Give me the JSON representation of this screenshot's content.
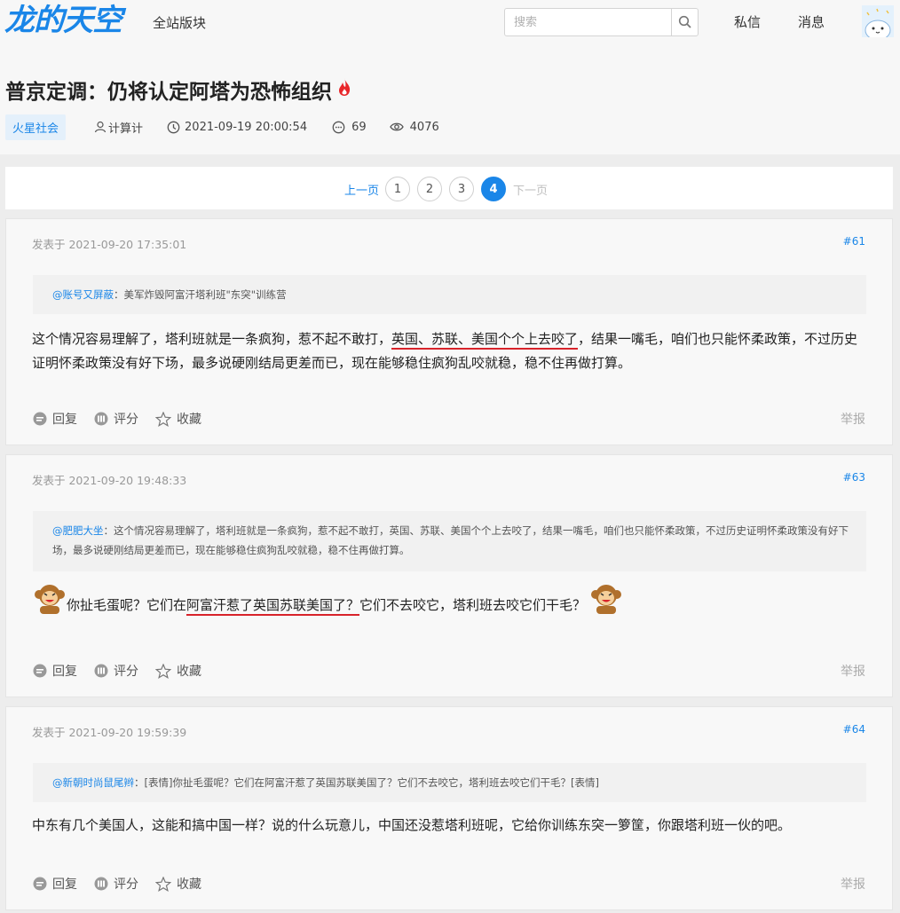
{
  "header": {
    "logo": "龙的天空",
    "nav_all": "全站版块",
    "search_placeholder": "搜索",
    "pm": "私信",
    "messages": "消息"
  },
  "thread": {
    "title": "普京定调：仍将认定阿塔为恐怖组织",
    "tag": "火星社会",
    "author": "计算计",
    "datetime": "2021-09-19 20:00:54",
    "replies": "69",
    "views": "4076"
  },
  "pagination": {
    "prev": "上一页",
    "pages": [
      "1",
      "2",
      "3",
      "4"
    ],
    "current": "4",
    "next": "下一页"
  },
  "actions": {
    "reply": "回复",
    "rate": "评分",
    "favorite": "收藏",
    "report": "举报"
  },
  "posts": [
    {
      "posted": "发表于 2021-09-20 17:35:01",
      "floor": "#61",
      "quote_user": "@账号又屏蔽",
      "quote_text": "：美军炸毁阿富汗塔利班\"东突\"训练营",
      "body_1": "这个情况容易理解了，塔利班就是一条疯狗，惹不起不敢打，",
      "body_hl": "英国、苏联、美国个个上去咬了",
      "body_2": "，结果一嘴毛，咱们也只能怀柔政策，不过历史证明怀柔政策没有好下场，最多说硬刚结局更差而已，现在能够稳住疯狗乱咬就稳，稳不住再做打算。"
    },
    {
      "posted": "发表于 2021-09-20 19:48:33",
      "floor": "#63",
      "quote_user": "@肥肥大坐",
      "quote_text": "：这个情况容易理解了，塔利班就是一条疯狗，惹不起不敢打，英国、苏联、美国个个上去咬了，结果一嘴毛，咱们也只能怀柔政策，不过历史证明怀柔政策没有好下场，最多说硬刚结局更差而已，现在能够稳住疯狗乱咬就稳，稳不住再做打算。",
      "body_1": "你扯毛蛋呢？它们在",
      "body_hl": "阿富汗惹了英国苏联美国了？",
      "body_2": "它们不去咬它，塔利班去咬它们干毛？"
    },
    {
      "posted": "发表于 2021-09-20 19:59:39",
      "floor": "#64",
      "quote_user": "@新朝时尚鼠尾辫",
      "quote_text": "：[表情]你扯毛蛋呢？它们在阿富汗惹了英国苏联美国了？它们不去咬它，塔利班去咬它们干毛？[表情]",
      "body_1": "中东有几个美国人，这能和搞中国一样？说的什么玩意儿，中国还没惹塔利班呢，它给你训练东突一箩筐，你跟塔利班一伙的吧。"
    }
  ]
}
